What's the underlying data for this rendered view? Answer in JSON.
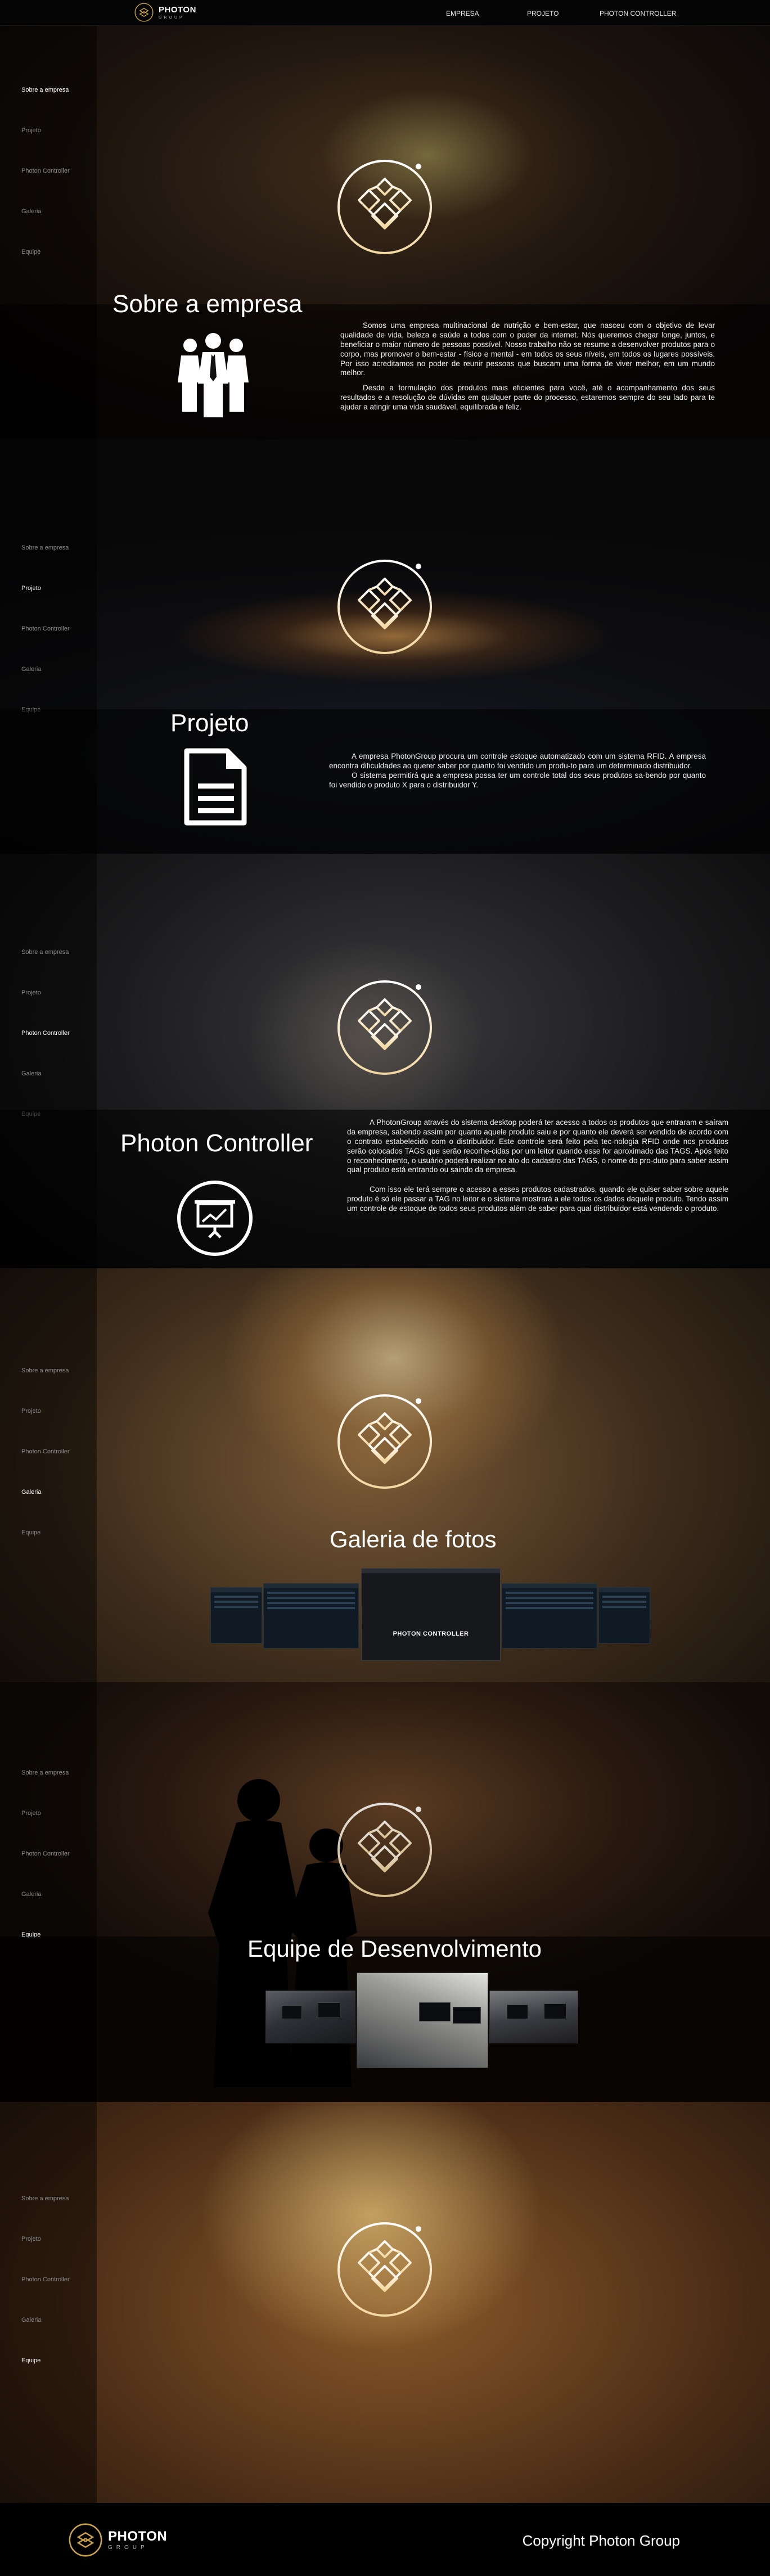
{
  "brand": {
    "name": "PHOTON",
    "sub": "GROUP"
  },
  "topnav": [
    "EMPRESA",
    "PROJETO",
    "PHOTON CONTROLLER"
  ],
  "sidenav": [
    "Sobre a empresa",
    "Projeto",
    "Photon Controller",
    "Galeria",
    "Equipe"
  ],
  "empresa": {
    "title": "Sobre a empresa",
    "p1": "Somos uma empresa multinacional de nutrição e bem-estar, que nasceu com o objetivo de levar qualidade de vida, beleza e saúde a todos com o poder da internet. Nós queremos chegar longe, juntos, e beneficiar o maior número de pessoas possível. Nosso trabalho não se resume a desenvolver produtos para o corpo, mas promover o bem-estar - físico e mental - em todos os seus níveis, em todos os lugares possíveis. Por isso acreditamos no poder de reunir pessoas que buscam uma forma de viver melhor, em um mundo melhor.",
    "p2": "Desde a formulação dos produtos mais eficientes para você, até o acompanhamento dos seus resultados e a resolução de dúvidas em qualquer parte do processo, estaremos sempre do seu lado para te ajudar a atingir uma vida saudável, equilibrada e feliz."
  },
  "projeto": {
    "title": "Projeto",
    "p1": "A empresa PhotonGroup procura um controle estoque automatizado com um sistema RFID. A empresa encontra dificuldades ao querer saber por quanto foi vendido um produ-to para um determinado distribuidor.",
    "p2": "O sistema permitirá que a empresa possa ter um controle total dos seus produtos sa-bendo por quanto foi vendido o produto X para o distribuidor Y."
  },
  "controller": {
    "title": "Photon Controller",
    "p1": "A PhotonGroup através do sistema desktop poderá ter acesso a todos os produtos que entraram e saíram da empresa, sabendo assim por quanto aquele produto saiu e por quanto ele deverá ser vendido de acordo com o contrato estabelecido com o distribuidor. Este controle será feito pela tec-nologia RFID onde nos produtos serão colocados TAGS que serão recorhe-cidas por um leitor quando esse for aproximado das TAGS. Após feito o reconhecimento, o usuário poderá realizar no ato do cadastro das TAGS, o nome do pro-duto para saber assim qual produto está entrando ou saindo da empresa.",
    "p2": "Com isso ele terá sempre o acesso a esses produtos cadastrados, quando ele quiser saber sobre aquele produto é só ele passar a TAG no leitor e o sistema mostrará a ele todos os dados daquele produto. Tendo assim um controle de estoque de todos seus produtos além de saber para qual distribuidor está vendendo o produto."
  },
  "galeria": {
    "title": "Galeria de fotos",
    "center_label": "PHOTON CONTROLLER"
  },
  "equipe": {
    "title": "Equipe de Desenvolvimento"
  },
  "footer": {
    "copyright": "Copyright Photon Group"
  }
}
